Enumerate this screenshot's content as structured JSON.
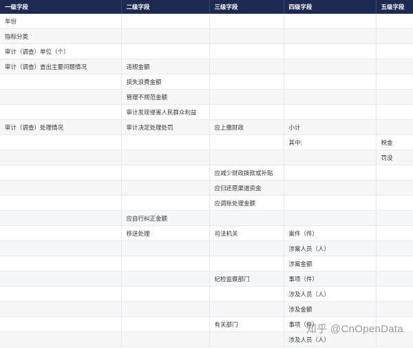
{
  "header": [
    "一级字段",
    "二级字段",
    "三级字段",
    "四级字段",
    "五级字段"
  ],
  "rows": [
    [
      "年份",
      "",
      "",
      "",
      ""
    ],
    [
      "指标分类",
      "",
      "",
      "",
      ""
    ],
    [
      "审计（调查）单位（个）",
      "",
      "",
      "",
      ""
    ],
    [
      "审计（调查）查出主要问题情况",
      "违规金额",
      "",
      "",
      ""
    ],
    [
      "",
      "损失浪费金额",
      "",
      "",
      ""
    ],
    [
      "",
      "管理不规范金额",
      "",
      "",
      ""
    ],
    [
      "",
      "审计发现侵害人民群众利益",
      "",
      "",
      ""
    ],
    [
      "审计（调查）处理情况",
      "审计决定处理处罚",
      "应上缴财政",
      "小计",
      ""
    ],
    [
      "",
      "",
      "",
      "其中:",
      "税金"
    ],
    [
      "",
      "",
      "",
      "",
      "罚没"
    ],
    [
      "",
      "",
      "应减少财政拨款或补贴",
      "",
      ""
    ],
    [
      "",
      "",
      "应归还原渠道资金",
      "",
      ""
    ],
    [
      "",
      "",
      "应调账处理金额",
      "",
      ""
    ],
    [
      "",
      "应自行纠正金额",
      "",
      "",
      ""
    ],
    [
      "",
      "移送处理",
      "司法机关",
      "案件（件）",
      ""
    ],
    [
      "",
      "",
      "",
      "涉案人员（人）",
      ""
    ],
    [
      "",
      "",
      "",
      "涉案金额",
      ""
    ],
    [
      "",
      "",
      "纪检监察部门",
      "事项（件）",
      ""
    ],
    [
      "",
      "",
      "",
      "涉及人员（人）",
      ""
    ],
    [
      "",
      "",
      "",
      "涉及金额",
      ""
    ],
    [
      "",
      "",
      "有关部门",
      "事项（件）",
      ""
    ],
    [
      "",
      "",
      "",
      "涉及人员（人）",
      ""
    ]
  ],
  "watermark": "知乎 @CnOpenData"
}
